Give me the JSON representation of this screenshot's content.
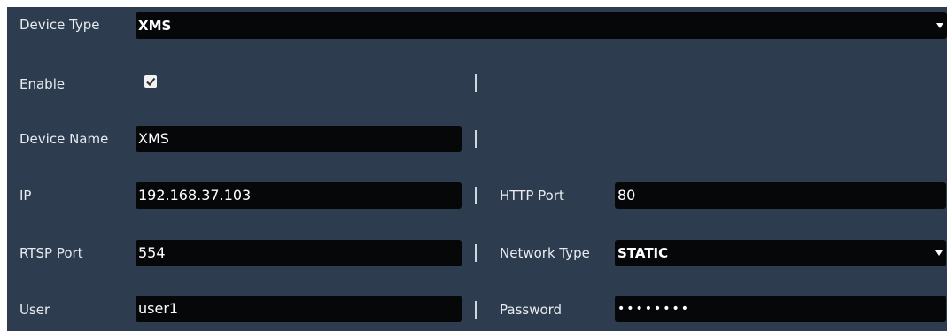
{
  "device_type": {
    "label": "Device Type",
    "value": "XMS"
  },
  "enable": {
    "label": "Enable",
    "checked": true
  },
  "device_name": {
    "label": "Device Name",
    "value": "XMS"
  },
  "ip": {
    "label": "IP",
    "value": "192.168.37.103"
  },
  "http_port": {
    "label": "HTTP Port",
    "value": "80"
  },
  "rtsp_port": {
    "label": "RTSP Port",
    "value": "554"
  },
  "network_type": {
    "label": "Network Type",
    "value": "STATIC"
  },
  "user": {
    "label": "User",
    "value": "user1"
  },
  "password": {
    "label": "Password",
    "value": "••••••••"
  },
  "colors": {
    "panel_bg": "#2e3c4f",
    "field_bg": "#060708",
    "text": "#e8ecf1"
  },
  "icons": [
    "chevron-down-icon",
    "checkmark-icon"
  ]
}
